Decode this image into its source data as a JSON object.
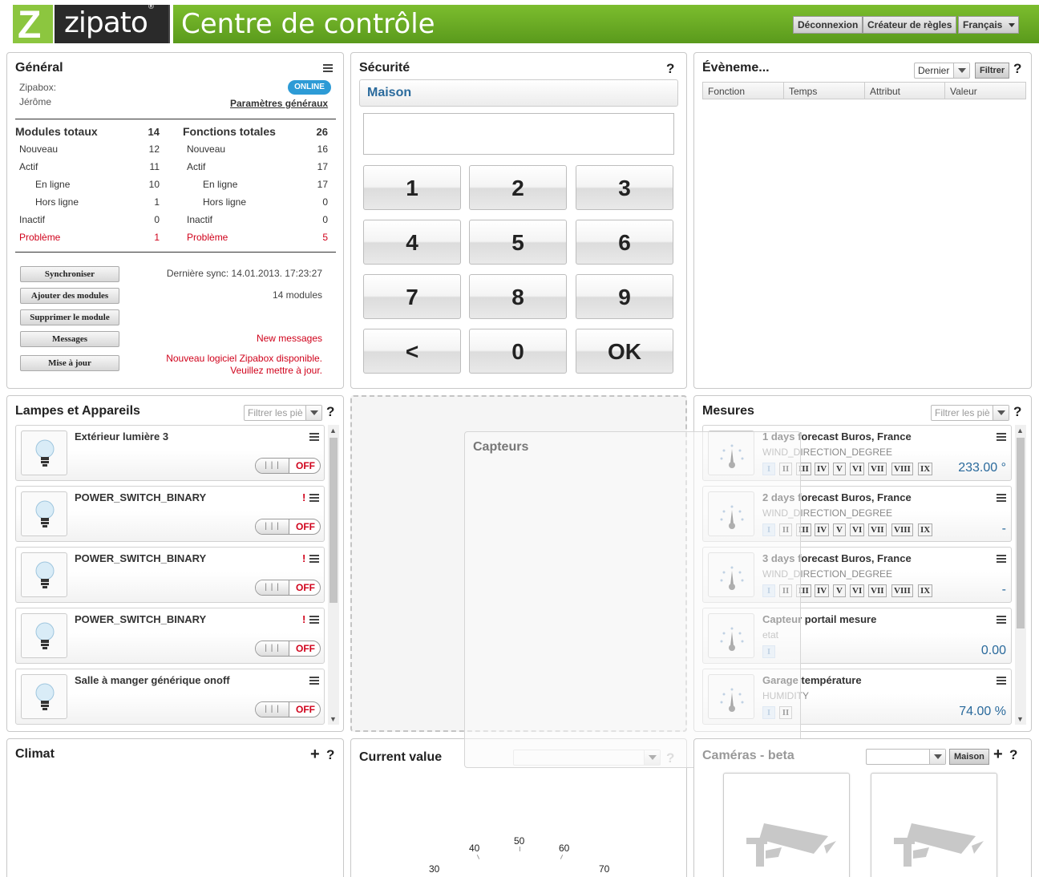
{
  "header": {
    "logo_letter": "Z",
    "logo_word": "zipato",
    "logo_reg": "®",
    "title": "Centre de contrôle",
    "buttons": {
      "logout": "Déconnexion",
      "rules": "Créateur de règles",
      "language": "Français"
    }
  },
  "general": {
    "title": "Général",
    "zipabox_label": "Zipabox:",
    "user": "Jérôme",
    "status_badge": "ONLINE",
    "settings_link": "Paramètres généraux",
    "modules": {
      "title": "Modules totaux",
      "total": "14",
      "rows": [
        {
          "label": "Nouveau",
          "value": "12"
        },
        {
          "label": "Actif",
          "value": "11"
        },
        {
          "label": "En ligne",
          "value": "10"
        },
        {
          "label": "Hors ligne",
          "value": "1"
        },
        {
          "label": "Inactif",
          "value": "0"
        },
        {
          "label": "Problème",
          "value": "1"
        }
      ]
    },
    "functions": {
      "title": "Fonctions totales",
      "total": "26",
      "rows": [
        {
          "label": "Nouveau",
          "value": "16"
        },
        {
          "label": "Actif",
          "value": "17"
        },
        {
          "label": "En ligne",
          "value": "17"
        },
        {
          "label": "Hors ligne",
          "value": "0"
        },
        {
          "label": "Inactif",
          "value": "0"
        },
        {
          "label": "Problème",
          "value": "5"
        }
      ]
    },
    "buttons": {
      "sync": "Synchroniser",
      "add": "Ajouter des modules",
      "delete": "Supprimer le module",
      "messages": "Messages",
      "update": "Mise à jour"
    },
    "last_sync": "Dernière sync: 14.01.2013. 17:23:27",
    "module_count": "14 modules",
    "new_messages": "New messages",
    "update_notice_1": "Nouveau logiciel Zipabox disponible.",
    "update_notice_2": "Veuillez mettre à jour."
  },
  "security": {
    "title": "Sécurité",
    "help": "?",
    "zone": "Maison",
    "keys": [
      "1",
      "2",
      "3",
      "4",
      "5",
      "6",
      "7",
      "8",
      "9",
      "<",
      "0",
      "OK"
    ]
  },
  "events": {
    "title": "Évèneme...",
    "select_value": "Dernier",
    "filter_button": "Filtrer",
    "help": "?",
    "columns": [
      "Fonction",
      "Temps",
      "Attribut",
      "Valeur"
    ]
  },
  "lamps": {
    "title": "Lampes et Appareils",
    "filter_placeholder": "Filtrer les piè",
    "help": "?",
    "grip": "| | |",
    "items": [
      {
        "name": "Extérieur lumière 3",
        "state": "OFF",
        "warning": ""
      },
      {
        "name": "POWER_SWITCH_BINARY",
        "state": "OFF",
        "warning": "!"
      },
      {
        "name": "POWER_SWITCH_BINARY",
        "state": "OFF",
        "warning": "!"
      },
      {
        "name": "POWER_SWITCH_BINARY",
        "state": "OFF",
        "warning": "!"
      },
      {
        "name": "Salle à manger générique onoff",
        "state": "OFF",
        "warning": ""
      }
    ]
  },
  "capteurs": {
    "title": "Capteurs"
  },
  "mesures": {
    "title": "Mesures",
    "filter_placeholder": "Filtrer les piè",
    "help": "?",
    "items": [
      {
        "name": "1 days forecast Buros, France",
        "sub": "WIND_DIRECTION_DEGREE",
        "value": "233.00 °"
      },
      {
        "name": "2 days forecast Buros, France",
        "sub": "WIND_DIRECTION_DEGREE",
        "value": "-"
      },
      {
        "name": "3 days forecast Buros, France",
        "sub": "WIND_DIRECTION_DEGREE",
        "value": "-"
      },
      {
        "name": "Capteur portail mesure",
        "sub": "etat",
        "value": "0.00"
      },
      {
        "name": "Garage température",
        "sub": "HUMIDITY",
        "value": "74.00 %"
      }
    ],
    "roman": [
      "I",
      "II",
      "III",
      "IV",
      "V",
      "VI",
      "VII",
      "VIII",
      "IX"
    ]
  },
  "climat": {
    "title": "Climat",
    "add": "+",
    "help": "?"
  },
  "current_value": {
    "title": "Current value",
    "help": "?",
    "gauge_labels": [
      "30",
      "40",
      "50",
      "60",
      "70"
    ]
  },
  "cameras": {
    "title": "Caméras - beta",
    "zone_button": "Maison",
    "add": "+",
    "help": "?"
  },
  "colors": {
    "brand_green": "#7cbd2e",
    "online_blue": "#2d9bd6",
    "problem_red": "#d0021b",
    "value_blue": "#2a6a9c"
  },
  "icons": [
    "menu-icon",
    "bulb-icon",
    "gauge-icon",
    "camera-icon",
    "dropdown-arrow-icon"
  ]
}
